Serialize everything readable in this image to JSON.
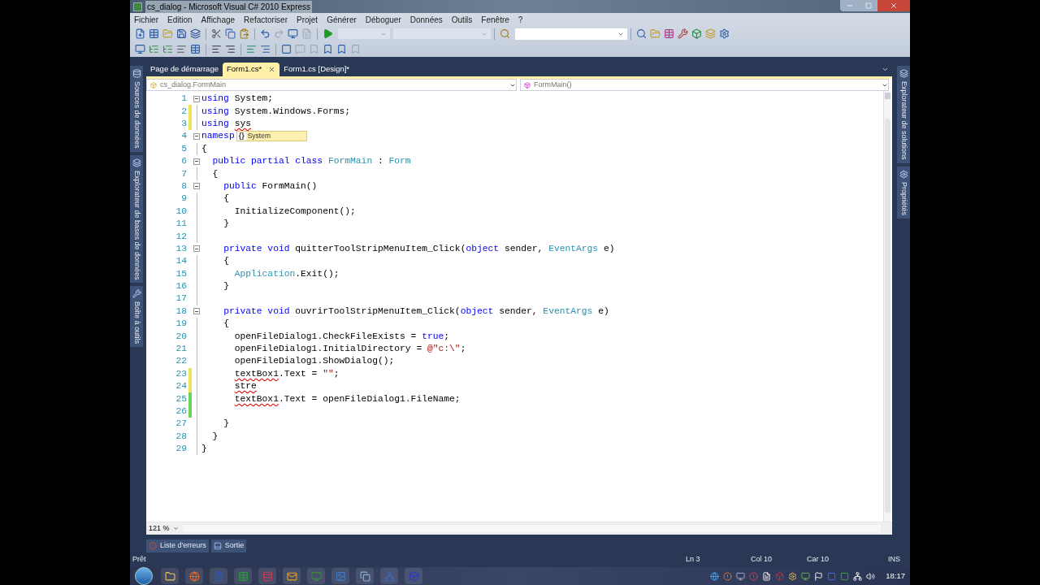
{
  "window": {
    "title": "cs_dialog - Microsoft Visual C# 2010 Express"
  },
  "menu": [
    "Fichier",
    "Edition",
    "Affichage",
    "Refactoriser",
    "Projet",
    "Générer",
    "Déboguer",
    "Données",
    "Outils",
    "Fenêtre",
    "?"
  ],
  "left_dock": [
    "Sources de données",
    "Explorateur de bases de données",
    "Boîte à outils"
  ],
  "right_dock": [
    "Explorateur de solutions",
    "Propriétés"
  ],
  "tabs": [
    {
      "label": "Page de démarrage",
      "selected": false
    },
    {
      "label": "Form1.cs*",
      "selected": true
    },
    {
      "label": "Form1.cs [Design]*",
      "selected": false
    }
  ],
  "nav_bar": {
    "type": "cs_dialog.FormMain",
    "member": "FormMain()"
  },
  "editor": {
    "completion_glyph": "{}",
    "completion": "System",
    "zoom": "121 %",
    "lines": [
      {
        "number": "1",
        "collapsible": true,
        "tokens": [
          {
            "kind": "keyword",
            "text": "using"
          },
          {
            "kind": "plain",
            "text": " System;"
          }
        ]
      },
      {
        "number": "2",
        "color": "#efe35a",
        "collapsible": false,
        "tokens": [
          {
            "kind": "keyword",
            "text": "using"
          },
          {
            "kind": "plain",
            "text": " System.Windows.Forms;"
          }
        ]
      },
      {
        "number": "3",
        "color": "#efe35a",
        "collapsible": false,
        "tokens": [
          {
            "kind": "keyword",
            "text": "using"
          },
          {
            "kind": "error",
            "text": " sys"
          }
        ]
      },
      {
        "number": "4",
        "collapsible": true,
        "completion": true,
        "tokens": [
          {
            "kind": "keyword",
            "text": "namesp"
          }
        ]
      },
      {
        "number": "5",
        "collapsible": false,
        "tokens": [
          {
            "kind": "plain",
            "text": "{"
          }
        ]
      },
      {
        "number": "6",
        "collapsible": true,
        "tokens": [
          {
            "kind": "keyword",
            "text": "  public partial class"
          },
          {
            "kind": "type",
            "text": " FormMain"
          },
          {
            "kind": "plain",
            "text": " : "
          },
          {
            "kind": "type",
            "text": "Form"
          }
        ]
      },
      {
        "number": "7",
        "collapsible": false,
        "tokens": [
          {
            "kind": "plain",
            "text": "  {"
          }
        ]
      },
      {
        "number": "8",
        "collapsible": true,
        "tokens": [
          {
            "kind": "keyword",
            "text": "    public"
          },
          {
            "kind": "plain",
            "text": " FormMain()"
          }
        ]
      },
      {
        "number": "9",
        "collapsible": false,
        "tokens": [
          {
            "kind": "plain",
            "text": "    {"
          }
        ]
      },
      {
        "number": "10",
        "collapsible": false,
        "tokens": [
          {
            "kind": "plain",
            "text": "      InitializeComponent();"
          }
        ]
      },
      {
        "number": "11",
        "collapsible": false,
        "tokens": [
          {
            "kind": "plain",
            "text": "    }"
          }
        ]
      },
      {
        "number": "12",
        "collapsible": false
      },
      {
        "number": "13",
        "collapsible": true,
        "tokens": [
          {
            "kind": "keyword",
            "text": "    private void"
          },
          {
            "kind": "plain",
            "text": " quitterToolStripMenuItem_Click("
          },
          {
            "kind": "keyword",
            "text": "object"
          },
          {
            "kind": "plain",
            "text": " sender, "
          },
          {
            "kind": "type",
            "text": "EventArgs"
          },
          {
            "kind": "plain",
            "text": " e)"
          }
        ]
      },
      {
        "number": "14",
        "collapsible": false,
        "tokens": [
          {
            "kind": "plain",
            "text": "    {"
          }
        ]
      },
      {
        "number": "15",
        "collapsible": false,
        "tokens": [
          {
            "kind": "type",
            "text": "      Application"
          },
          {
            "kind": "plain",
            "text": ".Exit();"
          }
        ]
      },
      {
        "number": "16",
        "collapsible": false,
        "tokens": [
          {
            "kind": "plain",
            "text": "    }"
          }
        ]
      },
      {
        "number": "17",
        "collapsible": false
      },
      {
        "number": "18",
        "collapsible": true,
        "tokens": [
          {
            "kind": "keyword",
            "text": "    private void"
          },
          {
            "kind": "plain",
            "text": " ouvrirToolStripMenuItem_Click("
          },
          {
            "kind": "keyword",
            "text": "object"
          },
          {
            "kind": "plain",
            "text": " sender, "
          },
          {
            "kind": "type",
            "text": "EventArgs"
          },
          {
            "kind": "plain",
            "text": " e)"
          }
        ]
      },
      {
        "number": "19",
        "collapsible": false,
        "tokens": [
          {
            "kind": "plain",
            "text": "    {"
          }
        ]
      },
      {
        "number": "20",
        "collapsible": false,
        "tokens": [
          {
            "kind": "plain",
            "text": "      openFileDialog1.CheckFileExists = "
          },
          {
            "kind": "keyword",
            "text": "true"
          },
          {
            "kind": "plain",
            "text": ";"
          }
        ]
      },
      {
        "number": "21",
        "collapsible": false,
        "tokens": [
          {
            "kind": "plain",
            "text": "      openFileDialog1.InitialDirectory = "
          },
          {
            "kind": "string",
            "text": "@\"c:\\\""
          },
          {
            "kind": "plain",
            "text": ";"
          }
        ]
      },
      {
        "number": "22",
        "collapsible": false,
        "tokens": [
          {
            "kind": "plain",
            "text": "      openFileDialog1.ShowDialog();"
          }
        ]
      },
      {
        "number": "23",
        "color": "#efe35a",
        "collapsible": false,
        "tokens": [
          {
            "kind": "error",
            "text": "      textBox1"
          },
          {
            "kind": "plain",
            "text": ".Text = "
          },
          {
            "kind": "string",
            "text": "\"\""
          },
          {
            "kind": "plain",
            "text": ";"
          }
        ]
      },
      {
        "number": "24",
        "color": "#efe35a",
        "collapsible": false,
        "tokens": [
          {
            "kind": "error",
            "text": "      stre"
          }
        ]
      },
      {
        "number": "25",
        "color": "#6cd25c",
        "collapsible": false,
        "tokens": [
          {
            "kind": "error",
            "text": "      textBox1"
          },
          {
            "kind": "plain",
            "text": ".Text = openFileDialog1.FileName;"
          }
        ]
      },
      {
        "number": "26",
        "color": "#6cd25c",
        "collapsible": false
      },
      {
        "number": "27",
        "collapsible": false,
        "tokens": [
          {
            "kind": "plain",
            "text": "    }"
          }
        ]
      },
      {
        "number": "28",
        "collapsible": false,
        "tokens": [
          {
            "kind": "plain",
            "text": "  }"
          }
        ]
      },
      {
        "number": "29",
        "collapsible": false,
        "tokens": [
          {
            "kind": "plain",
            "text": "}"
          }
        ]
      }
    ]
  },
  "bottom_tabs": [
    "Liste d'erreurs",
    "Sortie"
  ],
  "status_bar": {
    "message": "Prêt",
    "line": "Ln 3",
    "column": "Col 10",
    "char": "Car 10",
    "mode": "INS"
  },
  "taskbar": {
    "clock": "18:17"
  }
}
